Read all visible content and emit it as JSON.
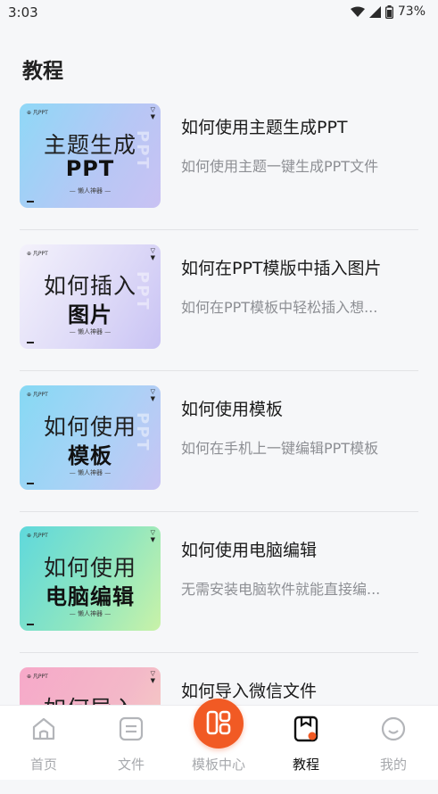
{
  "status": {
    "time": "3:03",
    "battery": "73%"
  },
  "page_title": "教程",
  "tutorials": [
    {
      "thumb_line1": "主题生成",
      "thumb_line2": "PPT",
      "thumb_sub": "— 懒人神器 —",
      "thumb_brand": "⊕ 凡PPT",
      "title": "如何使用主题生成PPT",
      "desc": "如何使用主题一键生成PPT文件"
    },
    {
      "thumb_line1": "如何插入",
      "thumb_line2": "图片",
      "thumb_sub": "— 懒人神器 —",
      "thumb_brand": "⊕ 凡PPT",
      "title": "如何在PPT模版中插入图片",
      "desc": "如何在PPT模板中轻松插入想..."
    },
    {
      "thumb_line1": "如何使用",
      "thumb_line2": "模板",
      "thumb_sub": "— 懒人神器 —",
      "thumb_brand": "⊕ 凡PPT",
      "title": "如何使用模板",
      "desc": "如何在手机上一键编辑PPT模板"
    },
    {
      "thumb_line1": "如何使用",
      "thumb_line2": "电脑编辑",
      "thumb_sub": "— 懒人神器 —",
      "thumb_brand": "⊕ 凡PPT",
      "title": "如何使用电脑编辑",
      "desc": "无需安装电脑软件就能直接编..."
    },
    {
      "thumb_line1": "如何导入",
      "thumb_line2": "",
      "thumb_sub": "",
      "thumb_brand": "⊕ 凡PPT",
      "title": "如何导入微信文件",
      "desc": ""
    }
  ],
  "nav": [
    {
      "label": "首页",
      "icon": "home-icon"
    },
    {
      "label": "文件",
      "icon": "file-icon"
    },
    {
      "label": "模板中心",
      "icon": "template-center-icon"
    },
    {
      "label": "教程",
      "icon": "tutorial-icon"
    },
    {
      "label": "我的",
      "icon": "profile-icon"
    }
  ],
  "colors": {
    "accent": "#f15a24",
    "background": "#f6f7f9"
  }
}
